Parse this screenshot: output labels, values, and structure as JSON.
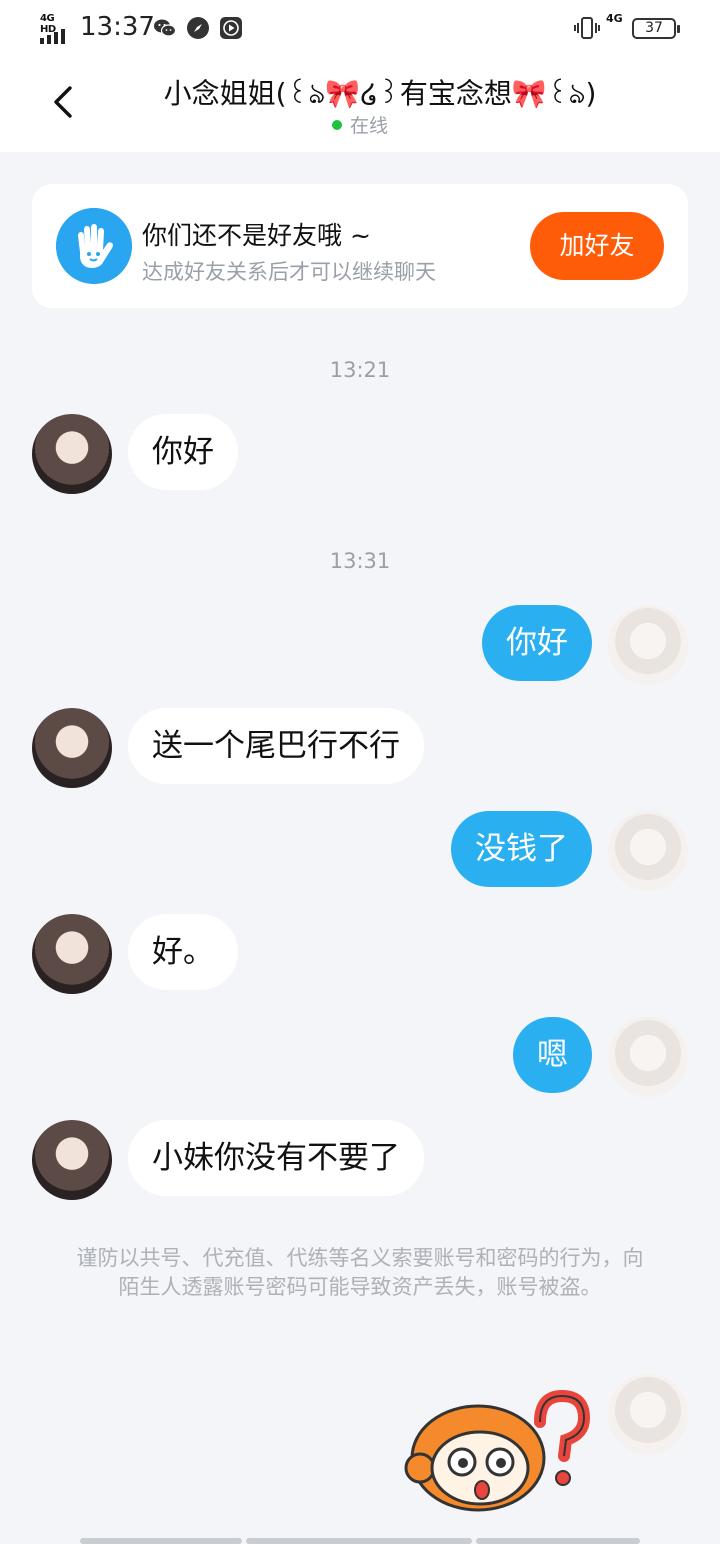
{
  "status_bar": {
    "network": "4G HD",
    "time": "13:37",
    "right_network": "4G",
    "battery": "37"
  },
  "header": {
    "title": "小念姐姐(꒰ঌ🎀໒꒱有宝念想🎀꒰ঌ)",
    "status": "在线"
  },
  "friend_banner": {
    "title": "你们还不是好友哦 ~",
    "subtitle": "达成好友关系后才可以继续聊天",
    "button_label": "加好友"
  },
  "timestamps": [
    "13:21",
    "13:31"
  ],
  "messages": [
    {
      "side": "in",
      "text": "你好"
    },
    {
      "side": "out",
      "text": "你好"
    },
    {
      "side": "in",
      "text": "送一个尾巴行不行"
    },
    {
      "side": "out",
      "text": "没钱了"
    },
    {
      "side": "in",
      "text": "好。"
    },
    {
      "side": "out",
      "text": "嗯"
    },
    {
      "side": "in",
      "text": "小妹你没有不要了"
    }
  ],
  "notice": "谨防以共号、代充值、代练等名义索要账号和密码的行为，向陌生人透露账号密码可能导致资产丢失，账号被盗。",
  "colors": {
    "accent_blue": "#2aaff0",
    "add_button": "#ff5c0a",
    "online_dot": "#1ec13c"
  },
  "icons": [
    "back-chevron-icon",
    "wave-hand-icon",
    "wechat-icon",
    "compass-icon",
    "play-icon",
    "vibrate-icon",
    "question-sticker"
  ]
}
